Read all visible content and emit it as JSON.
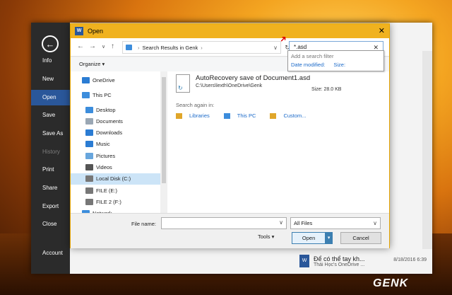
{
  "word": {
    "nav_items": [
      {
        "label": "Info",
        "state": "normal"
      },
      {
        "label": "New",
        "state": "normal"
      },
      {
        "label": "Open",
        "state": "active"
      },
      {
        "label": "Save",
        "state": "normal"
      },
      {
        "label": "Save As",
        "state": "normal"
      },
      {
        "label": "History",
        "state": "disabled"
      },
      {
        "label": "Print",
        "state": "normal"
      },
      {
        "label": "Share",
        "state": "normal"
      },
      {
        "label": "Export",
        "state": "normal"
      },
      {
        "label": "Close",
        "state": "normal"
      },
      {
        "label": "Account",
        "state": "normal"
      }
    ],
    "recent": {
      "title": "Để có thể tay kh...",
      "subtitle": "Thái Học's OneDrive ...",
      "date": "8/18/2016 6:39"
    }
  },
  "dialog": {
    "title": "Open",
    "icon_letter": "W",
    "address": {
      "path_label": "Search Results in Genk"
    },
    "search": {
      "value": "*.asd",
      "filter_hint": "Add a search filter",
      "filter_options": [
        "Date modified:",
        "Size:"
      ]
    },
    "organize_label": "Organize",
    "nav_tree": [
      {
        "label": "OneDrive",
        "icon": "onedrive-icon",
        "color": "#2b7cd3"
      },
      {
        "label": "This PC",
        "icon": "computer-icon",
        "color": "#3c8ddc"
      },
      {
        "label": "Desktop",
        "icon": "desktop-icon",
        "color": "#3c8ddc"
      },
      {
        "label": "Documents",
        "icon": "documents-icon",
        "color": "#9aa7b4"
      },
      {
        "label": "Downloads",
        "icon": "downloads-icon",
        "color": "#2b7cd3"
      },
      {
        "label": "Music",
        "icon": "music-icon",
        "color": "#2b7cd3"
      },
      {
        "label": "Pictures",
        "icon": "pictures-icon",
        "color": "#68a6dd"
      },
      {
        "label": "Videos",
        "icon": "videos-icon",
        "color": "#555555"
      },
      {
        "label": "Local Disk (C:)",
        "icon": "drive-icon",
        "color": "#777777",
        "selected": true
      },
      {
        "label": "FILE (E:)",
        "icon": "drive-icon",
        "color": "#777777"
      },
      {
        "label": "FILE 2 (F:)",
        "icon": "drive-icon",
        "color": "#777777"
      },
      {
        "label": "Network",
        "icon": "network-icon",
        "color": "#3c8ddc"
      }
    ],
    "result": {
      "name": "AutoRecovery save of Document1.asd",
      "path": "C:\\Users\\lexth\\OneDrive\\Genk",
      "size_label": "Size: 28.0 KB"
    },
    "search_again_label": "Search again in:",
    "search_again_items": [
      {
        "label": "Libraries",
        "icon": "libraries-icon"
      },
      {
        "label": "This PC",
        "icon": "computer-icon"
      },
      {
        "label": "Custom...",
        "icon": "custom-folder-icon"
      }
    ],
    "filename_label": "File name:",
    "filename_value": "",
    "filetype_value": "All Files",
    "tools_label": "Tools",
    "open_label": "Open",
    "cancel_label": "Cancel"
  },
  "watermark": "GENK"
}
